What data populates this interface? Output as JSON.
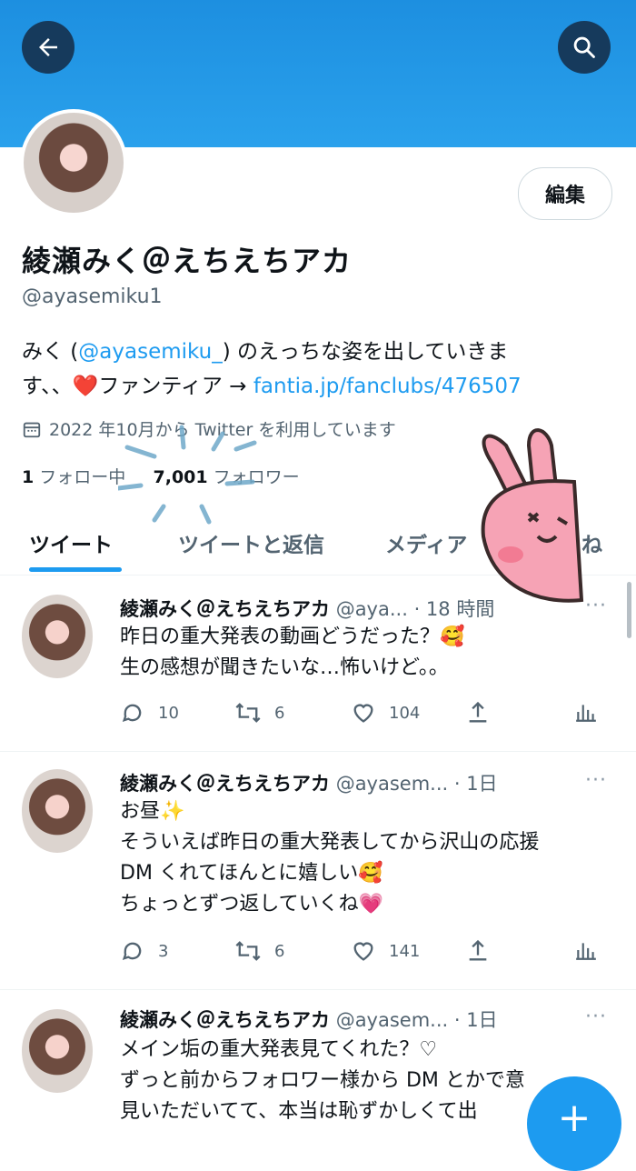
{
  "header": {
    "back_icon": "arrow-left-icon",
    "search_icon": "search-icon"
  },
  "profile": {
    "edit_label": "編集",
    "name": "綾瀬みく＠えちえちアカ",
    "handle": "@ayasemiku1",
    "bio_line1_pre": "みく (",
    "bio_mention": "@ayasemiku_",
    "bio_line1_post": ") のえっちな姿を出していきま",
    "bio_line2_pre": "す、、",
    "bio_heart": "❤️",
    "bio_line2_mid": "ファンティア → ",
    "bio_link": "fantia.jp/fanclubs/476507",
    "joined": "2022 年10月から Twitter を利用しています",
    "following_count": "1",
    "following_label": "フォロー中",
    "followers_count": "7,001",
    "followers_label": "フォロワー"
  },
  "tabs": [
    {
      "label": "ツイート"
    },
    {
      "label": "ツイートと返信"
    },
    {
      "label": "メディア"
    },
    {
      "label": "ね"
    }
  ],
  "tweets": [
    {
      "name": "綾瀬みく＠えちえちアカ",
      "handle": "@aya...",
      "time": "· 18 時間",
      "body": "昨日の重大発表の動画どうだった？🥰\n生の感想が聞きたいな…怖いけど。。",
      "replies": "10",
      "retweets": "6",
      "likes": "104"
    },
    {
      "name": "綾瀬みく＠えちえちアカ",
      "handle": "@ayasem...",
      "time": "· 1日",
      "body": "お昼✨\nそういえば昨日の重大発表してから沢山の応援\nDM くれてほんとに嬉しい🥰\nちょっとずつ返していくね💗",
      "replies": "3",
      "retweets": "6",
      "likes": "141"
    },
    {
      "name": "綾瀬みく＠えちえちアカ",
      "handle": "@ayasem...",
      "time": "· 1日",
      "body": "メイン垢の重大発表見てくれた？♡\nずっと前からフォロワー様から DM とかで意\n見いただいてて、本当は恥ずかしくて出",
      "replies": "",
      "retweets": "",
      "likes": ""
    }
  ],
  "fab_label": "+",
  "colors": {
    "accent": "#1d9bf0",
    "banner": "#2aa1ec",
    "text": "#0f1419",
    "muted": "#536471"
  }
}
